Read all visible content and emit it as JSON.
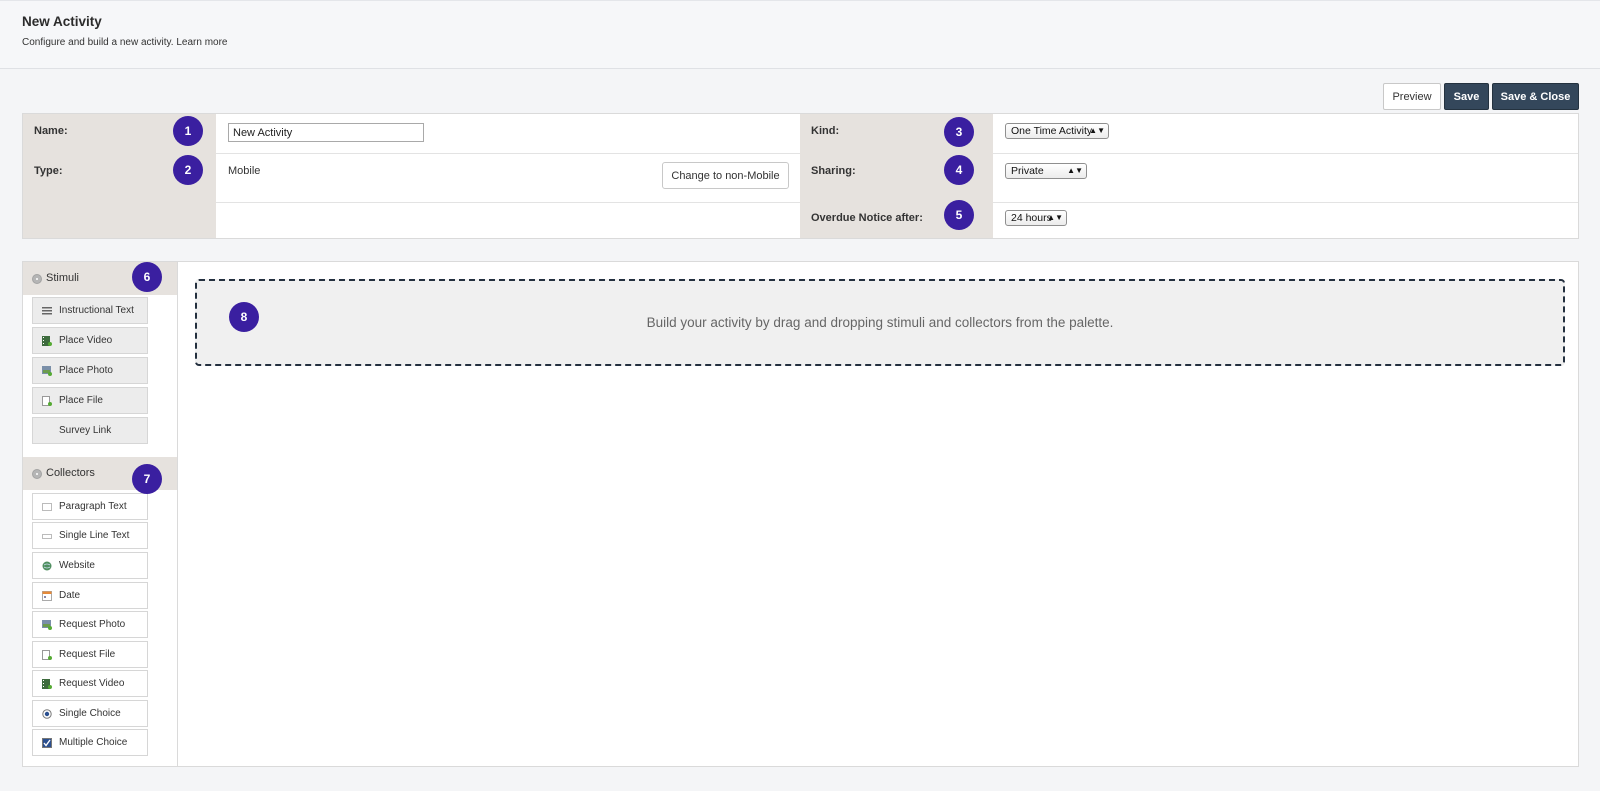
{
  "header": {
    "title": "New Activity",
    "subtitle": "Configure and build a new activity. Learn more"
  },
  "toolbar": {
    "preview_label": "Preview",
    "save_label": "Save",
    "save_close_label": "Save & Close"
  },
  "form": {
    "name_label": "Name:",
    "name_value": "New Activity",
    "type_label": "Type:",
    "type_value": "Mobile",
    "change_type_label": "Change to non-Mobile",
    "kind_label": "Kind:",
    "kind_value": "One Time Activity",
    "sharing_label": "Sharing:",
    "sharing_value": "Private",
    "overdue_label": "Overdue Notice after:",
    "overdue_value": "24 hours"
  },
  "badges": [
    "1",
    "2",
    "3",
    "4",
    "5",
    "6",
    "7",
    "8"
  ],
  "palette": {
    "stimuli_title": "Stimuli",
    "stimuli": [
      {
        "label": "Instructional Text",
        "icon": "text-lines-icon"
      },
      {
        "label": "Place Video",
        "icon": "film-icon"
      },
      {
        "label": "Place Photo",
        "icon": "photo-icon"
      },
      {
        "label": "Place File",
        "icon": "file-add-icon"
      },
      {
        "label": "Survey Link",
        "icon": ""
      }
    ],
    "collectors_title": "Collectors",
    "collectors": [
      {
        "label": "Paragraph Text",
        "icon": "textarea-icon"
      },
      {
        "label": "Single Line Text",
        "icon": "textfield-icon"
      },
      {
        "label": "Website",
        "icon": "globe-icon"
      },
      {
        "label": "Date",
        "icon": "calendar-icon"
      },
      {
        "label": "Request Photo",
        "icon": "photo-icon"
      },
      {
        "label": "Request File",
        "icon": "file-add-icon"
      },
      {
        "label": "Request Video",
        "icon": "film-icon"
      },
      {
        "label": "Single Choice",
        "icon": "radio-icon"
      },
      {
        "label": "Multiple Choice",
        "icon": "checkbox-icon"
      }
    ]
  },
  "canvas": {
    "placeholder": "Build your activity by drag and dropping stimuli and collectors from the palette."
  }
}
